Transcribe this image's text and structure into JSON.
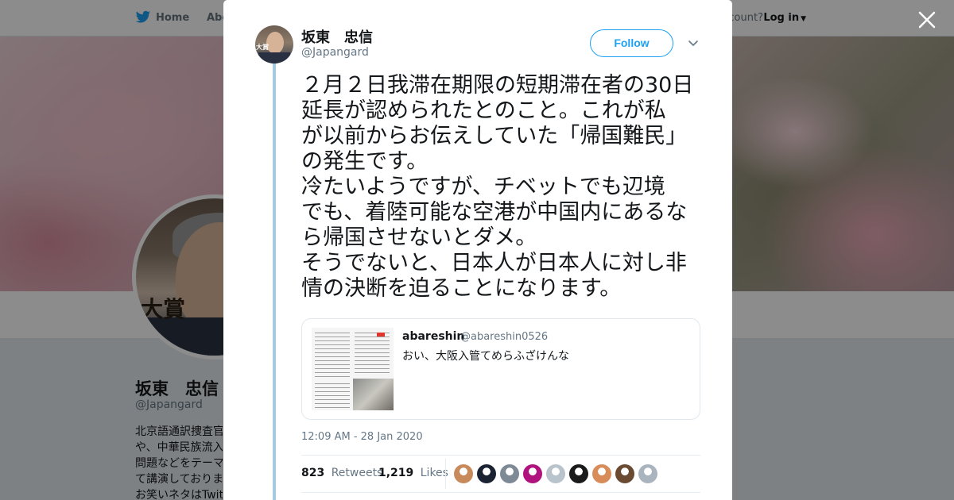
{
  "nav": {
    "home": "Home",
    "about": "Abo",
    "account_prompt": "ccount?",
    "login": "Log in"
  },
  "profile": {
    "name": "坂東　忠信",
    "handle": "@Japangard",
    "avatar_tag": "大賞",
    "bio_lines": [
      "北京語通訳捜査官",
      "や、中華民族流入",
      "問題などをテーマ",
      "て講演しておりま",
      "お笑いネタはTwitt"
    ]
  },
  "tweet": {
    "avatar_tag": "大賞",
    "author_name": "坂東　忠信",
    "author_handle": "@Japangard",
    "follow_label": "Follow",
    "text_lines": [
      "２月２日我滞在期限の短期滞在者の30日",
      "延長が認められたとのこと。これが私",
      "が以前からお伝えしていた「帰国難民」",
      "の発生です。",
      "冷たいようですが、チベットでも辺境",
      "でも、着陸可能な空港が中国内にあるな",
      "ら帰国させないとダメ。",
      "そうでないと、日本人が日本人に対し非",
      "情の決断を迫ることになります。"
    ],
    "quote": {
      "name": "abareshin",
      "handle": "@abareshin0526",
      "text": "おい、大阪入管てめらふざけんな"
    },
    "timestamp": "12:09 AM - 28 Jan 2020",
    "retweets_count": "823",
    "retweets_label": "Retweets",
    "likes_count": "1,219",
    "likes_label": "Likes",
    "liker_colors": [
      "#c98a5b",
      "#1b2333",
      "#7d8a96",
      "#b0127e",
      "#b9c3cc",
      "#1a1a1a",
      "#d88c5a",
      "#6b4a32",
      "#aab4be"
    ]
  },
  "colors": {
    "accent": "#1da1f2",
    "thread_line": "#a3cbe6"
  }
}
